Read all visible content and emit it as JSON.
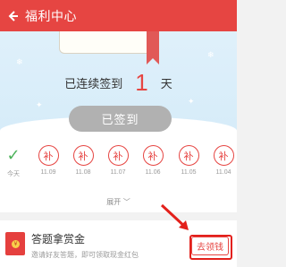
{
  "header": {
    "back_icon": "arrow-left-icon",
    "title": "福利中心",
    "color": "#e64542"
  },
  "checkin": {
    "prefix": "已连续签到",
    "days": "1",
    "suffix": "天",
    "button_label": "已签到"
  },
  "calendar": {
    "days": [
      {
        "mark": "✓",
        "label": "今天",
        "status": "done"
      },
      {
        "mark": "补",
        "label": "11.09",
        "status": "makeup"
      },
      {
        "mark": "补",
        "label": "11.08",
        "status": "makeup"
      },
      {
        "mark": "补",
        "label": "11.07",
        "status": "makeup"
      },
      {
        "mark": "补",
        "label": "11.06",
        "status": "makeup"
      },
      {
        "mark": "补",
        "label": "11.05",
        "status": "makeup"
      },
      {
        "mark": "补",
        "label": "11.04",
        "status": "makeup"
      }
    ],
    "expand_label": "展开 ﹀"
  },
  "task": {
    "icon": "red-envelope-icon",
    "title": "答题拿赏金",
    "description": "邀请好友答题，即可领取现金红包",
    "button_label": "去领钱"
  },
  "annotation": {
    "color": "#e3201b"
  }
}
